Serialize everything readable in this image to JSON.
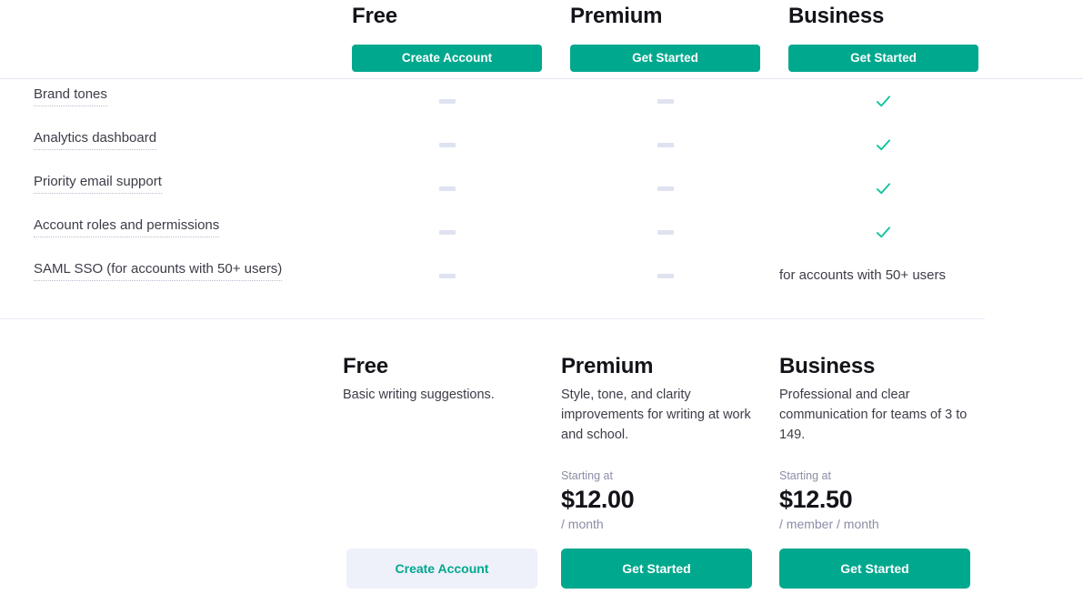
{
  "comparison": {
    "columns": [
      {
        "key": "free",
        "title": "Free",
        "cta_label": "Create Account"
      },
      {
        "key": "premium",
        "title": "Premium",
        "cta_label": "Get Started"
      },
      {
        "key": "business",
        "title": "Business",
        "cta_label": "Get Started"
      }
    ],
    "rows": [
      {
        "label": "Brand tones",
        "free": {
          "type": "dash"
        },
        "premium": {
          "type": "dash"
        },
        "business": {
          "type": "check"
        }
      },
      {
        "label": "Analytics dashboard",
        "free": {
          "type": "dash"
        },
        "premium": {
          "type": "dash"
        },
        "business": {
          "type": "check"
        }
      },
      {
        "label": "Priority email support",
        "free": {
          "type": "dash"
        },
        "premium": {
          "type": "dash"
        },
        "business": {
          "type": "check"
        }
      },
      {
        "label": "Account roles and permissions",
        "free": {
          "type": "dash"
        },
        "premium": {
          "type": "dash"
        },
        "business": {
          "type": "check"
        }
      },
      {
        "label": "SAML SSO (for accounts with 50+ users)",
        "free": {
          "type": "dash"
        },
        "premium": {
          "type": "dash"
        },
        "business": {
          "type": "text",
          "text": "for accounts with 50+ users"
        }
      }
    ]
  },
  "cards": [
    {
      "key": "free",
      "title": "Free",
      "description": "Basic writing suggestions.",
      "starting_label": "",
      "price": "",
      "period": "",
      "cta_label": "Create Account",
      "cta_style": "secondary"
    },
    {
      "key": "premium",
      "title": "Premium",
      "description": "Style, tone, and clarity improvements for writing at work and school.",
      "starting_label": "Starting at",
      "price": "$12.00",
      "period": "/ month",
      "cta_label": "Get Started",
      "cta_style": "primary"
    },
    {
      "key": "business",
      "title": "Business",
      "description": "Professional and clear communication for teams of 3 to 149.",
      "starting_label": "Starting at",
      "price": "$12.50",
      "period": "/ member / month",
      "cta_label": "Get Started",
      "cta_style": "primary"
    }
  ],
  "colors": {
    "accent_green": "#00a88e",
    "dash_gray": "#dfe2f0",
    "secondary_button_bg": "#eef0fa",
    "divider_top": "#e4e6ef",
    "divider_bottom": "#eceaf9"
  },
  "icons": {
    "check": "check-icon",
    "dash": "dash-icon"
  }
}
